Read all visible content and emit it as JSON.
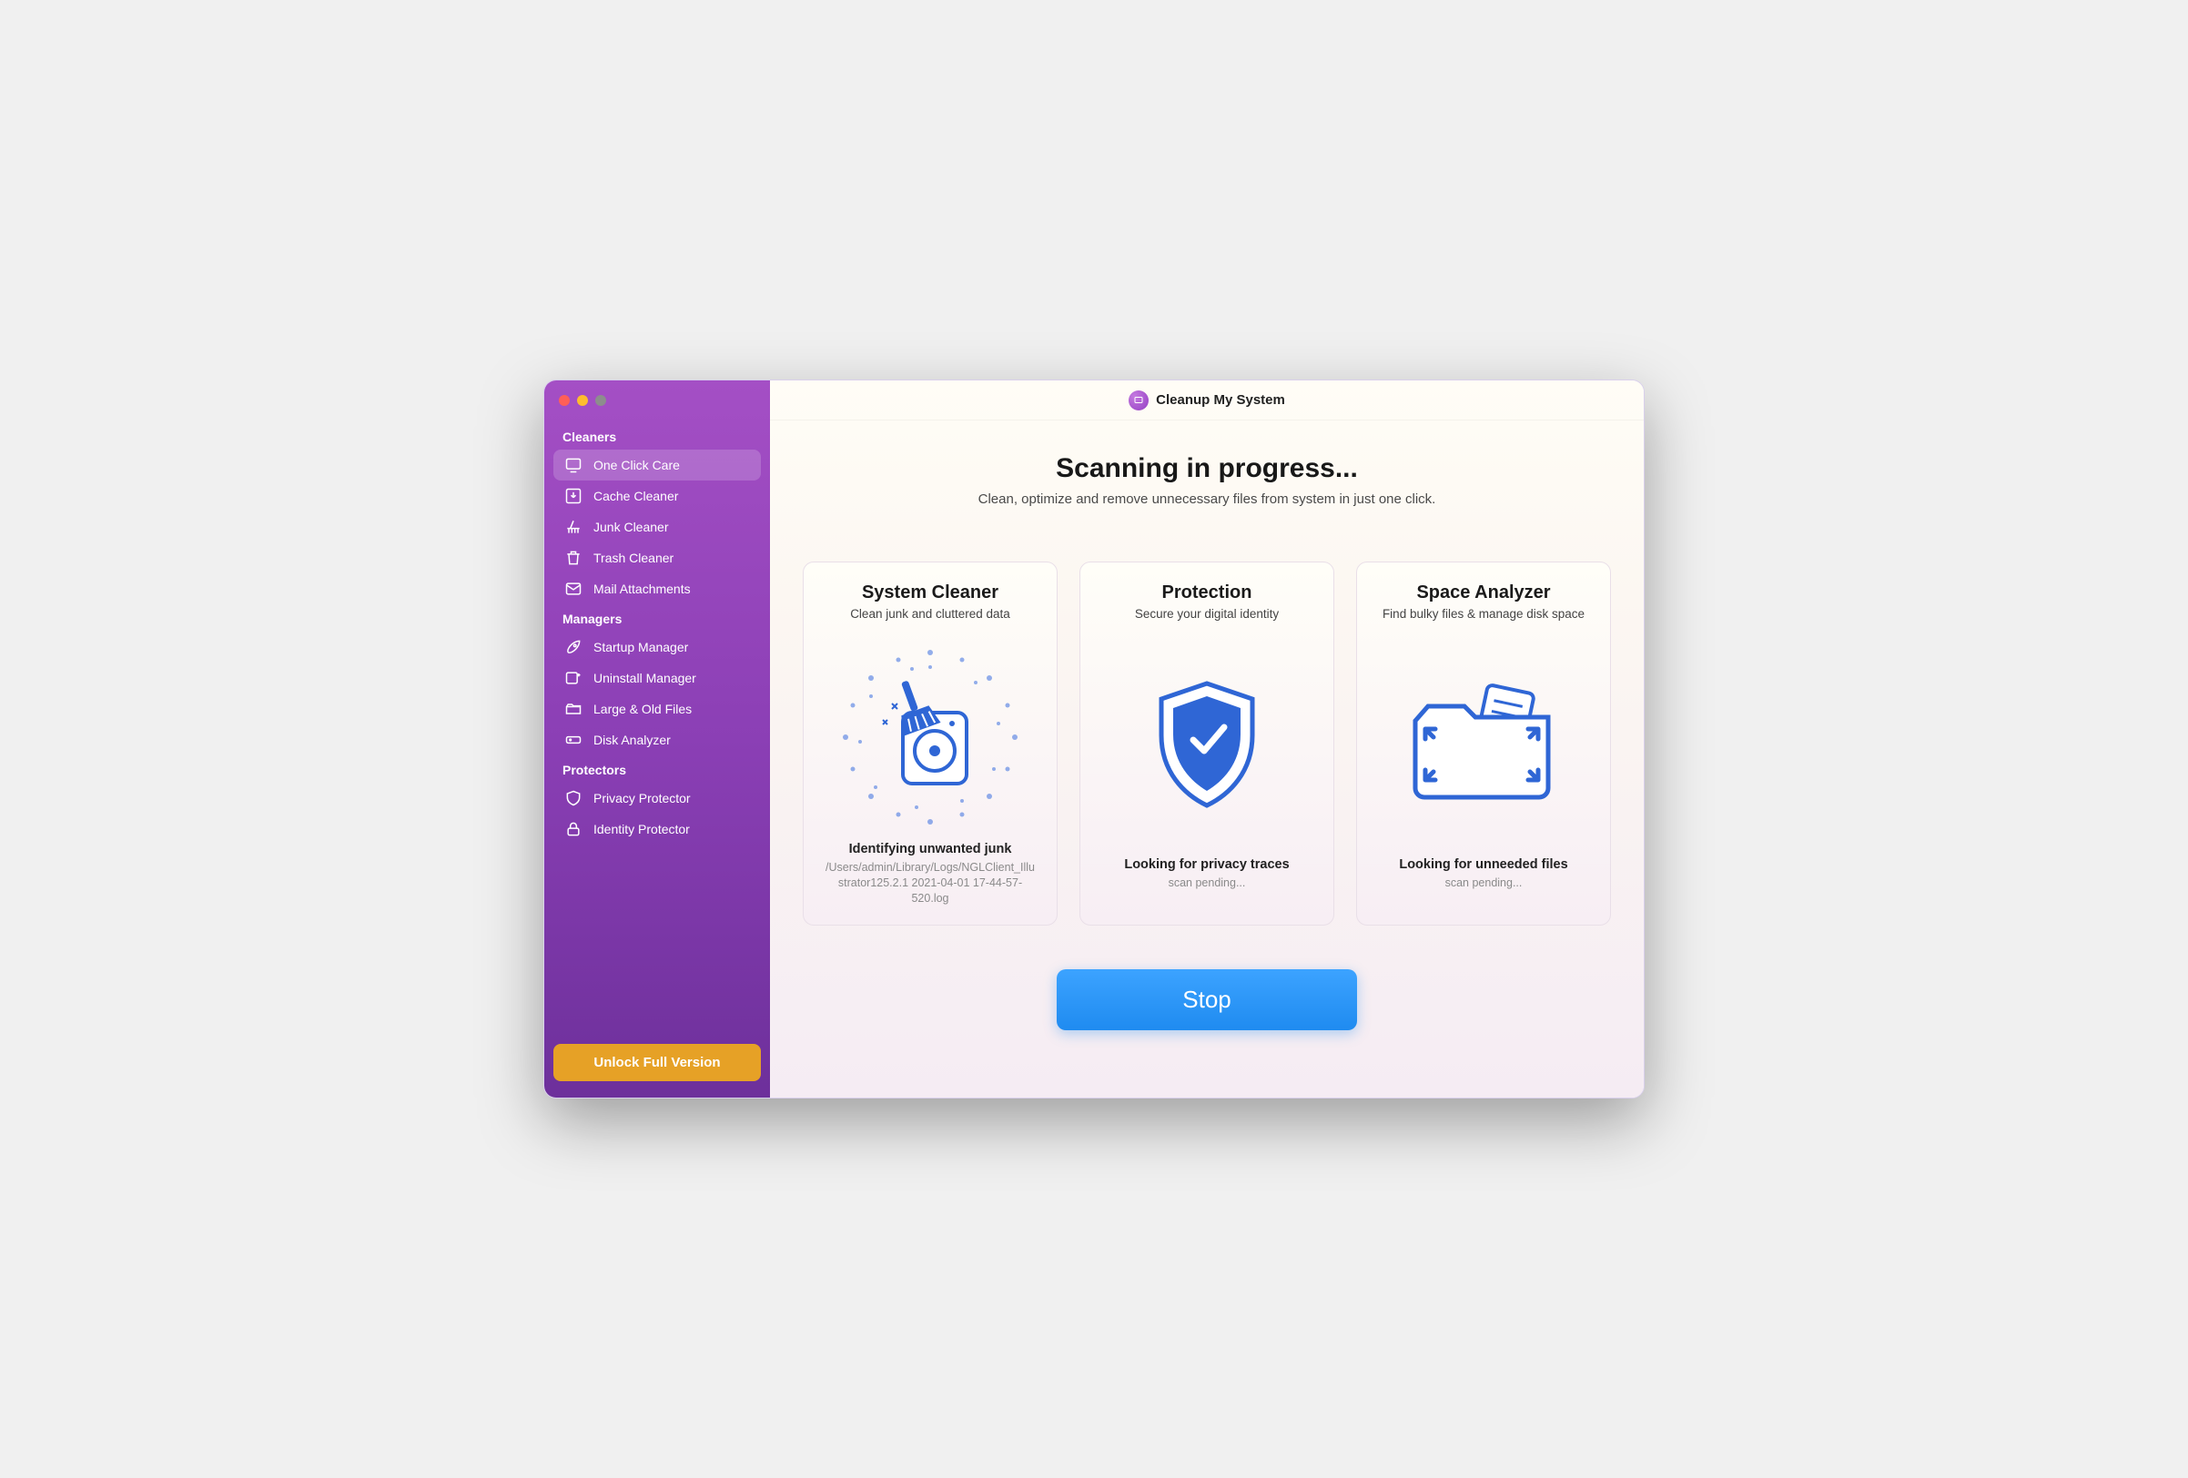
{
  "app": {
    "title": "Cleanup My System"
  },
  "sidebar": {
    "sections": [
      {
        "title": "Cleaners",
        "items": [
          {
            "id": "one-click-care",
            "label": "One Click Care",
            "icon": "monitor",
            "active": true
          },
          {
            "id": "cache-cleaner",
            "label": "Cache Cleaner",
            "icon": "download-box",
            "active": false
          },
          {
            "id": "junk-cleaner",
            "label": "Junk Cleaner",
            "icon": "broom",
            "active": false
          },
          {
            "id": "trash-cleaner",
            "label": "Trash Cleaner",
            "icon": "trash",
            "active": false
          },
          {
            "id": "mail-attachments",
            "label": "Mail Attachments",
            "icon": "mail",
            "active": false
          }
        ]
      },
      {
        "title": "Managers",
        "items": [
          {
            "id": "startup-manager",
            "label": "Startup Manager",
            "icon": "rocket",
            "active": false
          },
          {
            "id": "uninstall-manager",
            "label": "Uninstall Manager",
            "icon": "uninstall",
            "active": false
          },
          {
            "id": "large-old-files",
            "label": "Large & Old Files",
            "icon": "folder-stack",
            "active": false
          },
          {
            "id": "disk-analyzer",
            "label": "Disk Analyzer",
            "icon": "disk",
            "active": false
          }
        ]
      },
      {
        "title": "Protectors",
        "items": [
          {
            "id": "privacy-protector",
            "label": "Privacy Protector",
            "icon": "shield",
            "active": false
          },
          {
            "id": "identity-protector",
            "label": "Identity Protector",
            "icon": "lock",
            "active": false
          }
        ]
      }
    ],
    "unlock_label": "Unlock Full Version"
  },
  "hero": {
    "title": "Scanning in progress...",
    "subtitle": "Clean, optimize and remove unnecessary files from system in just one click."
  },
  "cards": [
    {
      "id": "system-cleaner",
      "title": "System Cleaner",
      "subtitle": "Clean junk and cluttered data",
      "graphic": "disk-broom",
      "status": "Identifying unwanted junk",
      "detail": "/Users/admin/Library/Logs/NGLClient_Illustrator125.2.1 2021-04-01 17-44-57-520.log"
    },
    {
      "id": "protection",
      "title": "Protection",
      "subtitle": "Secure your digital identity",
      "graphic": "shield-check",
      "status": "Looking for privacy traces",
      "detail": "scan pending..."
    },
    {
      "id": "space-analyzer",
      "title": "Space Analyzer",
      "subtitle": "Find bulky files & manage disk space",
      "graphic": "folder-expand",
      "status": "Looking for unneeded files",
      "detail": "scan pending..."
    }
  ],
  "action": {
    "stop_label": "Stop"
  },
  "colors": {
    "accent_blue": "#2f66d5",
    "sidebar_gradient_top": "#a44fc5",
    "sidebar_gradient_bottom": "#6d309b",
    "unlock_orange": "#e6a126",
    "stop_blue": "#1f8bf0"
  }
}
